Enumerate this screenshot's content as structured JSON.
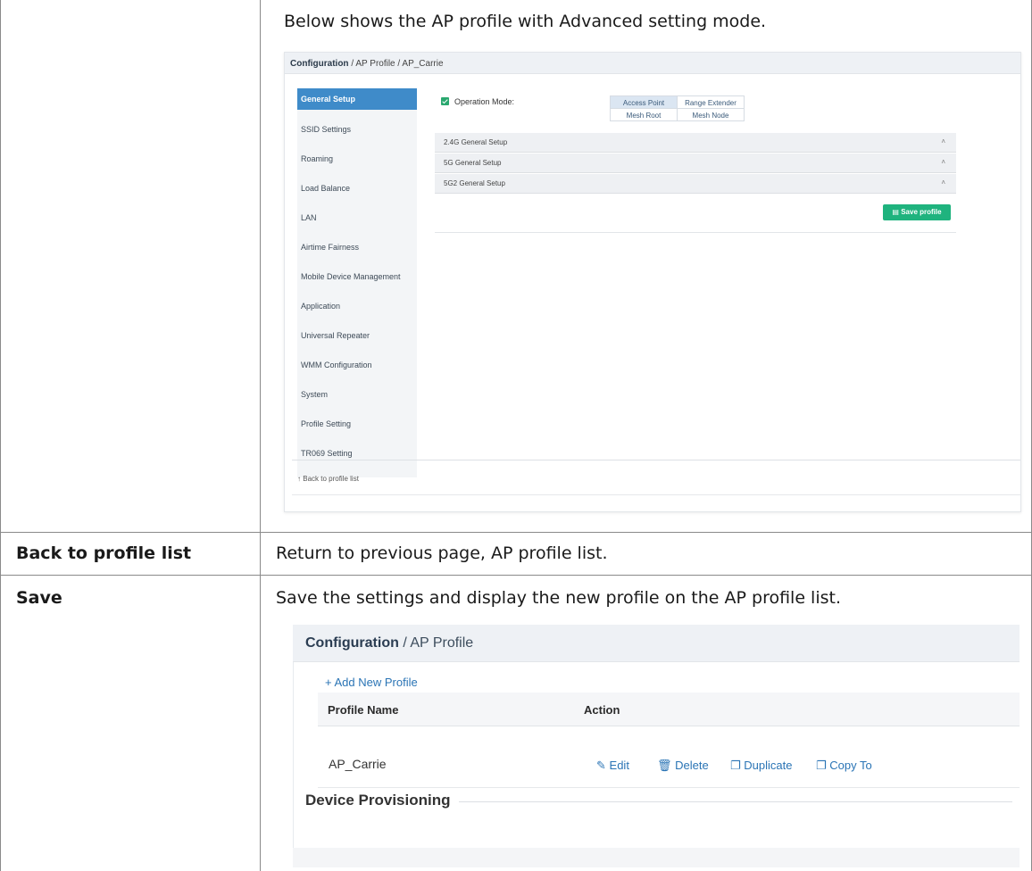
{
  "doc": {
    "intro_text": "Below shows the AP profile with Advanced setting mode.",
    "rows": [
      {
        "label": "Back to profile list",
        "description": "Return to previous page, AP profile list."
      },
      {
        "label": "Save",
        "description": "Save the settings and display the new profile on the AP profile list."
      }
    ]
  },
  "shot1": {
    "breadcrumb_root": "Configuration",
    "breadcrumb_rest": " / AP Profile / AP_Carrie",
    "sidebar": [
      "General Setup",
      "SSID Settings",
      "Roaming",
      "Load Balance",
      "LAN",
      "Airtime Fairness",
      "Mobile Device Management",
      "Application",
      "Universal Repeater",
      "WMM Configuration",
      "System",
      "Profile Setting",
      "TR069 Setting"
    ],
    "operation_mode_label": "Operation Mode:",
    "modes": [
      "Access Point",
      "Range Extender",
      "Mesh Root",
      "Mesh Node"
    ],
    "selected_mode": "Access Point",
    "sections": [
      "2.4G General Setup",
      "5G General Setup",
      "5G2 General Setup"
    ],
    "save_button": "Save profile",
    "back_link": "Back to profile list",
    "colors": {
      "active": "#3f8bc9",
      "save": "#1fb37e",
      "check": "#2aa86f"
    }
  },
  "shot2": {
    "breadcrumb_root": "Configuration",
    "breadcrumb_rest": " / AP Profile",
    "add_link": "+ Add New Profile",
    "headers": [
      "Profile Name",
      "Action"
    ],
    "profile_name": "AP_Carrie",
    "actions": [
      "Edit",
      "Delete",
      "Duplicate",
      "Copy To"
    ],
    "section_title": "Device Provisioning"
  }
}
